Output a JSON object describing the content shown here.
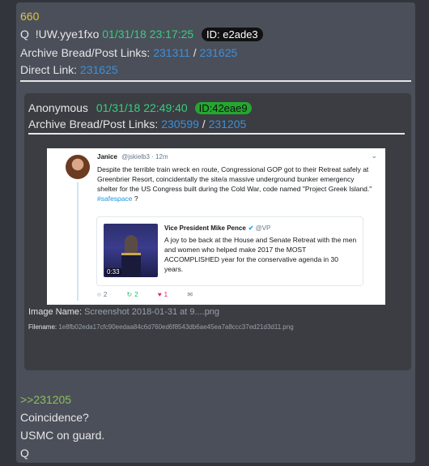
{
  "post": {
    "number": "660",
    "author": "Q",
    "tripcode": "!UW.yye1fxo",
    "date": "01/31/18 23:17:25",
    "id_label": "ID: e2ade3",
    "archive_label": "Archive Bread/Post Links:",
    "archive_link_1": "231311",
    "slash": "/",
    "archive_link_2": "231625",
    "direct_label": "Direct Link:",
    "direct_link": "231625",
    "reply_ref": ">>231205",
    "lines": [
      "Coincidence?",
      "USMC on guard.",
      "Q"
    ]
  },
  "quoted_post": {
    "author": "Anonymous",
    "date": "01/31/18 22:49:40",
    "id_label": "ID:42eae9",
    "archive_label": "Archive Bread/Post Links:",
    "archive_link_1": "230599",
    "slash": "/",
    "archive_link_2": "231205",
    "image_name_label": "Image Name:",
    "image_name": "Screenshot 2018-01-31 at 9....png",
    "filename_label": "Filename:",
    "filename": "1e8fb02eda17cfc90eedaa84c6d760ed6f8543db6ae45ea7a8ccc37ed21d3d11.png"
  },
  "tweet": {
    "name": "Janice",
    "handle": "@jskielb3 · 12m",
    "chevron": "⌄",
    "text_main": "Despite the terrible train wreck en route, Congressional GOP got to their Retreat safely at Greenbrier Resort, coincidentally the site/a massive underground bunker emergency shelter for the US Congress built during the Cold War, code named \"Project Greek Island.\" ",
    "hashtag": "#safespace",
    "text_end": " ?",
    "quote": {
      "name": "Vice President Mike Pence",
      "verified": "✔",
      "handle": "@VP",
      "text": "A joy to be back at the House and Senate Retreat with the men and women who helped make 2017 the MOST ACCOMPLISHED year for the conservative agenda in 30 years.",
      "video_time": "0:33"
    },
    "actions": {
      "reply_icon": "speech-bubble-icon",
      "reply_count": "2",
      "retweet_icon": "retweet-icon",
      "retweet_count": "2",
      "like_icon": "heart-icon",
      "like_count": "1",
      "dm_icon": "envelope-icon"
    },
    "colors": {
      "link": "#1b95e0",
      "retweet": "#17bf63",
      "like": "#e0245e"
    }
  },
  "colors": {
    "page_bg": "#33353c",
    "post_bg": "#4b4f5a",
    "inner_bg": "#3b3d43",
    "post_number": "#e0c43a",
    "date": "#33d17a",
    "link": "#3e8fd6",
    "greentext": "#8fbf5a"
  }
}
